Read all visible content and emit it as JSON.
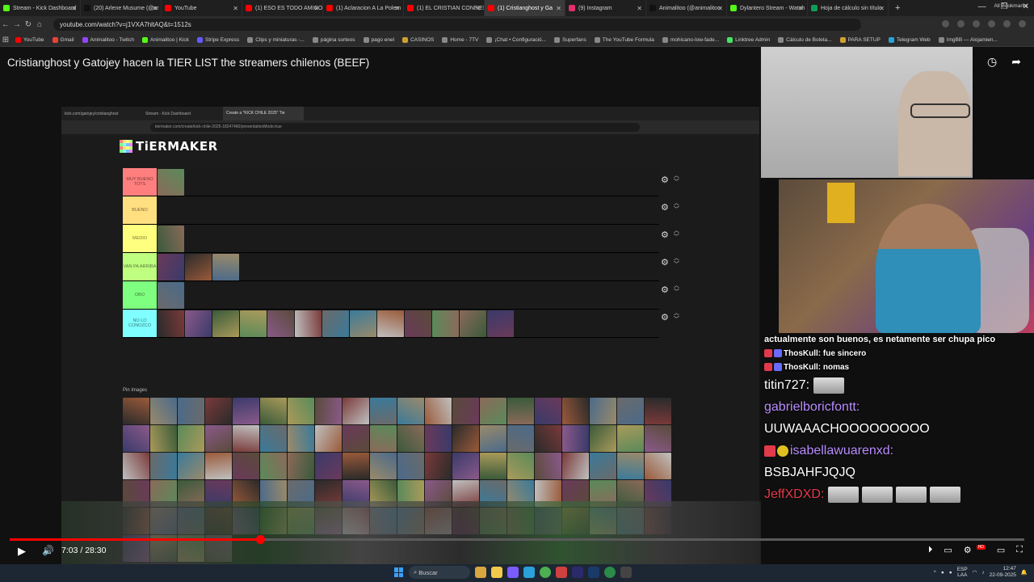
{
  "browser": {
    "tabs": [
      {
        "label": "Stream - Kick Dashboard",
        "color": "#53fc18",
        "active": false
      },
      {
        "label": "(20) Arlene Musume (@ar",
        "color": "#111111",
        "active": false
      },
      {
        "label": "YouTube",
        "color": "#ff0000",
        "active": false
      },
      {
        "label": "(1) ESO ES TODO AMIGO",
        "color": "#ff0000",
        "active": false
      },
      {
        "label": "(1) Aclaracion A La Polem",
        "color": "#ff0000",
        "active": false
      },
      {
        "label": "(1) EL CRISTIAN CONFIES",
        "color": "#ff0000",
        "active": false
      },
      {
        "label": "(1) Cristianghost y Ga",
        "color": "#ff0000",
        "active": true
      },
      {
        "label": "(9) Instagram",
        "color": "#e1306c",
        "active": false
      },
      {
        "label": "Animalitoo (@animalitoo",
        "color": "#111111",
        "active": false
      },
      {
        "label": "Dylantero Stream - Watch",
        "color": "#53fc18",
        "active": false
      },
      {
        "label": "Hoja de cálculo sin título",
        "color": "#0f9d58",
        "active": false
      }
    ],
    "address": "youtube.com/watch?v=j1VXA7hltAQ&t=1512s",
    "bookmarks": [
      {
        "label": "YouTube",
        "color": "#ff0000"
      },
      {
        "label": "Gmail",
        "color": "#ea4335"
      },
      {
        "label": "Animalitoo - Twitch",
        "color": "#9146ff"
      },
      {
        "label": "Animalitoo | Kick",
        "color": "#53fc18"
      },
      {
        "label": "Stripe Express",
        "color": "#635bff"
      },
      {
        "label": "Clips y miniaturas -...",
        "color": "#888888"
      },
      {
        "label": "página sorteos",
        "color": "#888888"
      },
      {
        "label": "pago enel",
        "color": "#888888"
      },
      {
        "label": "CASINOS",
        "color": "#d0a030"
      },
      {
        "label": "Home - 7TV",
        "color": "#888888"
      },
      {
        "label": "¡Chat • Configuració...",
        "color": "#888888"
      },
      {
        "label": "Superfans",
        "color": "#888888"
      },
      {
        "label": "The YouTube Formula",
        "color": "#888888"
      },
      {
        "label": "mohicano-low-fade...",
        "color": "#888888"
      },
      {
        "label": "Linktree Admin",
        "color": "#43e660"
      },
      {
        "label": "Cálculo de Boleta...",
        "color": "#888888"
      },
      {
        "label": "PARA SETUP",
        "color": "#d0a030"
      },
      {
        "label": "Telegram Web",
        "color": "#2aa1da"
      },
      {
        "label": "ImgBB — Alojamien...",
        "color": "#888888"
      }
    ],
    "all_bookmarks": "All Bookmarks"
  },
  "video": {
    "title": "Cristianghost y Gatojey hacen la TIER LIST the streamers chilenos (BEEF)",
    "current_time": "7:03",
    "separator": " / ",
    "duration": "28:30",
    "progress": 0.247
  },
  "inner_browser": {
    "tabs": [
      "kick.com/gatojey/cristianghost",
      "Stream - Kick Dashboard",
      "Create a \"KICK CHILE 2025\" Tie"
    ],
    "address": "tiermaker.com/create/kick-chile-2025-18247460/presentationMode.true"
  },
  "tiermaker": {
    "logo": "TiERMAKER",
    "pin_label": "Pin Images",
    "tiers": [
      {
        "label": "MUY BUENO TOTS",
        "color": "#ff7f7f",
        "items": 1
      },
      {
        "label": "BUENO",
        "color": "#ffdf80",
        "items": 0
      },
      {
        "label": "MEDIO",
        "color": "#ffff7f",
        "items": 1
      },
      {
        "label": "VAN PA ARRIBA",
        "color": "#bfff7f",
        "items": 3
      },
      {
        "label": "OBO",
        "color": "#7fff7f",
        "items": 1
      },
      {
        "label": "NO LO CONOZCO",
        "color": "#7fffff",
        "items": 13
      }
    ],
    "pool_count": 104
  },
  "chat": {
    "overlay_lines": [
      {
        "user": "",
        "text": "actualmente son buenos, es netamente ser chupa pico"
      },
      {
        "user": "ThosKull:",
        "text": " fue sincero"
      },
      {
        "user": "ThosKull:",
        "text": " nomas"
      }
    ],
    "messages": [
      {
        "user": "titin727:",
        "text": "",
        "user_color": "#ffffff"
      },
      {
        "user": "gabrielboricfontt:",
        "text": "",
        "user_color": "#b98cff"
      },
      {
        "user": "",
        "text": "UUWAAACHOOOOOOOOO",
        "user_color": "#ffffff"
      },
      {
        "user": "isabellawuarenxd:",
        "text": "",
        "user_color": "#b98cff"
      },
      {
        "user": "",
        "text": "BSBJAHFJQJQ",
        "user_color": "#ffffff"
      },
      {
        "user": "JeffXDXD:",
        "text": "",
        "user_color": "#e23a4a"
      }
    ]
  },
  "taskbar": {
    "search_placeholder": "Buscar",
    "lang_top": "ESP",
    "lang_bottom": "LAA",
    "time": "12:47",
    "date": "22-09-2025"
  }
}
